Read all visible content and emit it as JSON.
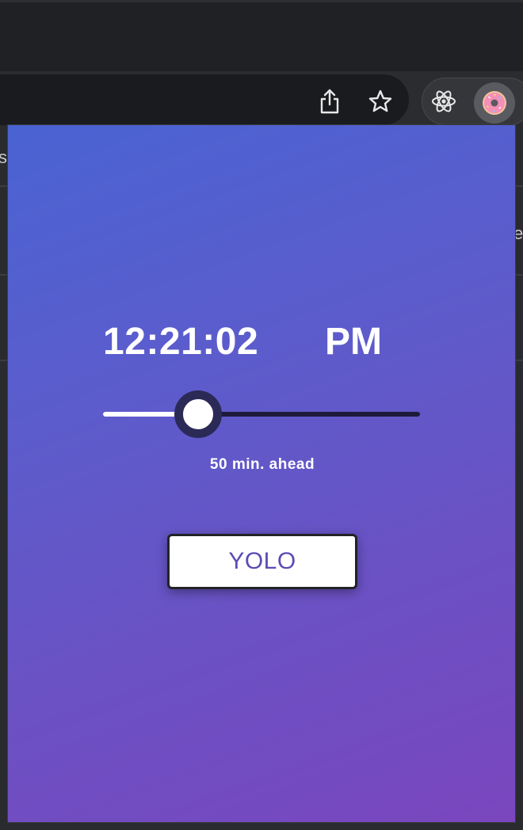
{
  "browser": {
    "toolbar_icons": [
      "share-icon",
      "star-icon",
      "react-extension-icon",
      "donut-extension-icon"
    ],
    "behind_page_text": [
      "s",
      "e"
    ]
  },
  "popup": {
    "time": "12:21:02",
    "ampm": "PM",
    "slider": {
      "value_fraction": 0.3
    },
    "ahead_label": "50 min. ahead",
    "button_label": "YOLO"
  },
  "colors": {
    "gradient_start": "#4a63d2",
    "gradient_end": "#7a46be",
    "button_text": "#5a4cb4",
    "thumb_ring": "#2b2a57"
  }
}
